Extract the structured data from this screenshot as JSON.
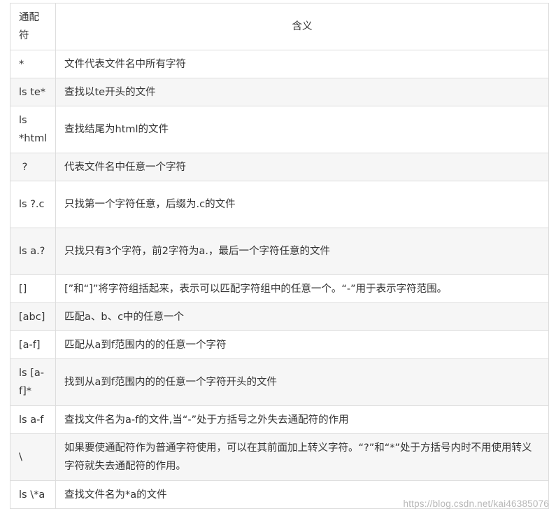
{
  "table": {
    "headers": [
      "通配符",
      "含义"
    ],
    "rows": [
      {
        "pattern": "*",
        "meaning": "文件代表文件名中所有字符"
      },
      {
        "pattern": "ls te*",
        "meaning": "查找以te开头的文件"
      },
      {
        "pattern": "ls *html",
        "meaning": "查找结尾为html的文件"
      },
      {
        "pattern": " ?",
        "meaning": "代表文件名中任意一个字符"
      },
      {
        "pattern": "ls ?.c",
        "meaning": "只找第一个字符任意，后缀为.c的文件"
      },
      {
        "pattern": "ls a.?",
        "meaning": "只找只有3个字符，前2字符为a.，最后一个字符任意的文件"
      },
      {
        "pattern": "[]",
        "meaning": "[”和“]”将字符组括起来，表示可以匹配字符组中的任意一个。“-”用于表示字符范围。"
      },
      {
        "pattern": "[abc]",
        "meaning": "匹配a、b、c中的任意一个"
      },
      {
        "pattern": "[a-f]",
        "meaning": "匹配从a到f范围内的的任意一个字符"
      },
      {
        "pattern": "ls [a-f]*",
        "meaning": "找到从a到f范围内的的任意一个字符开头的文件"
      },
      {
        "pattern": "ls a-f",
        "meaning": "查找文件名为a-f的文件,当“-”处于方括号之外失去通配符的作用"
      },
      {
        "pattern": "\\",
        "meaning": "如果要使通配符作为普通字符使用，可以在其前面加上转义字符。“?”和“*”处于方括号内时不用使用转义字符就失去通配符的作用。"
      },
      {
        "pattern": "ls \\*a",
        "meaning": "查找文件名为*a的文件"
      }
    ]
  },
  "watermark": "https://blog.csdn.net/kai46385076"
}
